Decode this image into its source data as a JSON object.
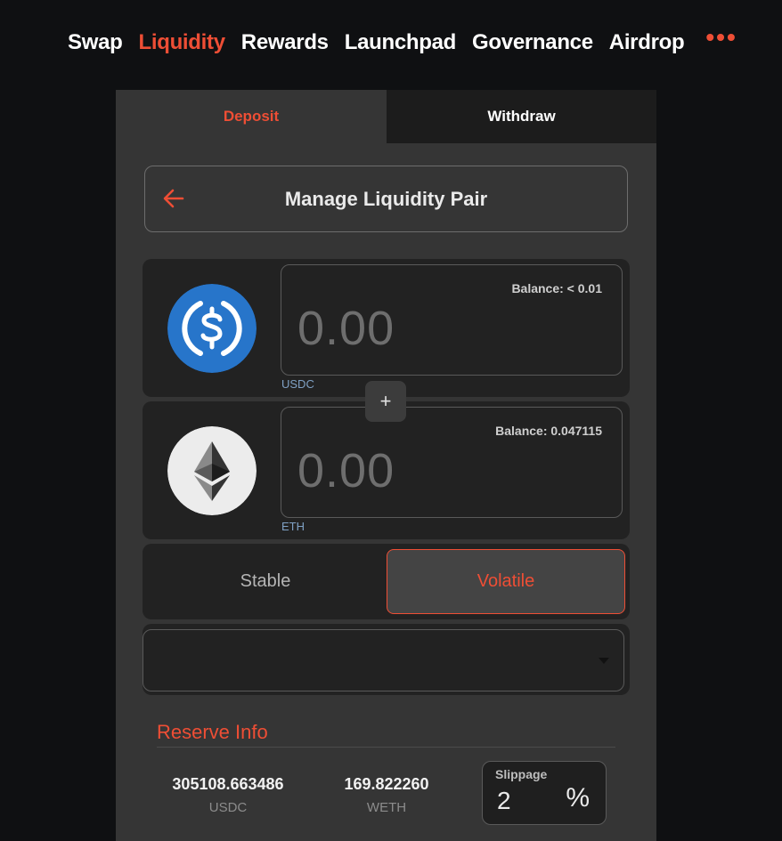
{
  "nav": {
    "items": [
      "Swap",
      "Liquidity",
      "Rewards",
      "Launchpad",
      "Governance",
      "Airdrop"
    ],
    "active": "Liquidity",
    "more_label": "•••"
  },
  "tabs": {
    "deposit": "Deposit",
    "withdraw": "Withdraw"
  },
  "header": {
    "title": "Manage Liquidity Pair"
  },
  "token_a": {
    "balance": "Balance: < 0.01",
    "amount_placeholder": "0.00",
    "symbol": "USDC",
    "icon": "usdc-logo"
  },
  "plus": "+",
  "token_b": {
    "balance": "Balance: 0.047115",
    "amount_placeholder": "0.00",
    "symbol": "ETH",
    "icon": "eth-logo"
  },
  "pool_type": {
    "stable": "Stable",
    "volatile": "Volatile",
    "selected": "Volatile"
  },
  "reserve": {
    "title": "Reserve Info",
    "a_value": "305108.663486",
    "a_unit": "USDC",
    "b_value": "169.822260",
    "b_unit": "WETH"
  },
  "slippage": {
    "label": "Slippage",
    "value": "2",
    "unit": "%"
  },
  "colors": {
    "accent": "#ee4e35",
    "usdc_blue": "#2775ca"
  }
}
